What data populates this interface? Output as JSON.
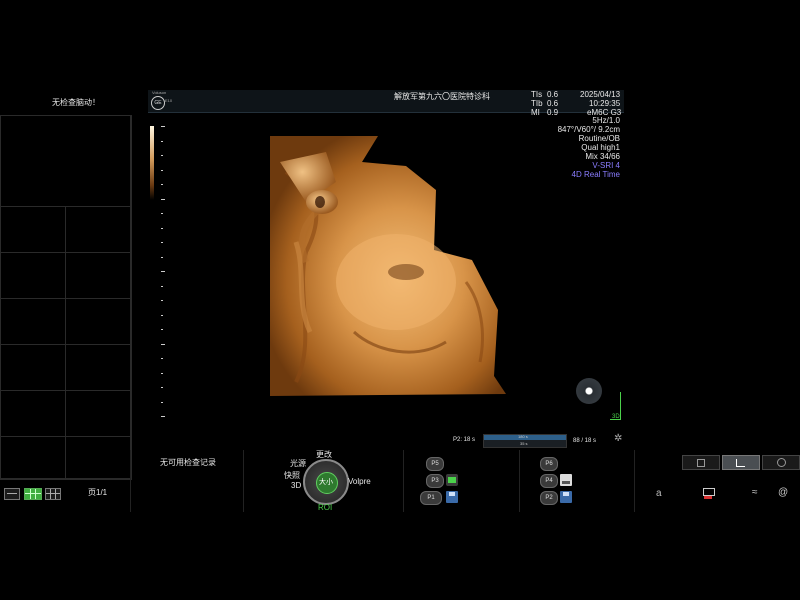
{
  "left_panel": {
    "title": "无检查脑动！",
    "page": "页1/1"
  },
  "header": {
    "hospital": "解放军第九六〇医院特诊科",
    "probe_brand_line1": "Voluson",
    "probe_brand_line2": "E10",
    "logo_text": "GE",
    "indices": [
      {
        "label": "TIs",
        "value": "0.6"
      },
      {
        "label": "TIb",
        "value": "0.6"
      },
      {
        "label": "MI",
        "value": "0.9"
      }
    ],
    "date": "2025/04/13",
    "time": "10:29:35",
    "probe": "eM6C G3"
  },
  "params": [
    {
      "text": "5Hz/1.0",
      "color": "#e8e8e8"
    },
    {
      "text": "847°/V60°/ 9.2cm",
      "color": "#e8e8e8"
    },
    {
      "text": "Routine/OB",
      "color": "#e8e8e8"
    },
    {
      "text": "Qual high1",
      "color": "#e8e8e8"
    },
    {
      "text": "Mix 34/66",
      "color": "#e8e8e8"
    },
    {
      "text": "V-SRI 4",
      "color": "#8a7dff"
    },
    {
      "text": "4D Real Time",
      "color": "#8a7dff"
    }
  ],
  "corner_3d_label": "3D",
  "cine": {
    "p2": "P2: 18 s",
    "top": "180 s",
    "bottom": "35 s",
    "right": "88 / 18 s"
  },
  "bottom": {
    "no_records": "无可用检查记录",
    "knob": {
      "top": "更改",
      "upper_left": "光源",
      "left": "快照",
      "left2": "3D",
      "center": "大小",
      "right": "Volpre",
      "bottom": "ROI"
    },
    "presets_left": [
      "P5",
      "P3",
      "P1"
    ],
    "presets_right": [
      "P6",
      "P4",
      "P2"
    ],
    "right_glyph": "a"
  },
  "colors": {
    "accent_green": "#4bd14b",
    "sepia": "#c48a4a",
    "cine_bar": "#2d5f8a"
  }
}
